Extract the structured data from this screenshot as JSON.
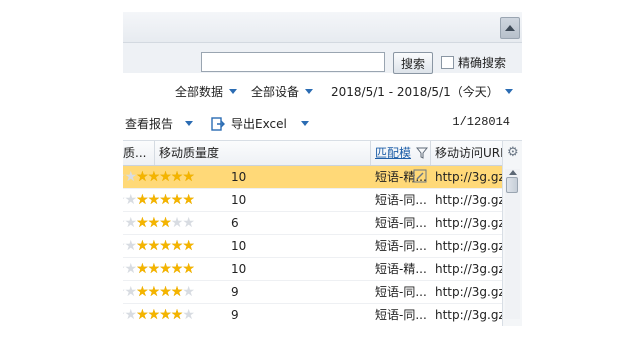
{
  "search": {
    "value": "",
    "button_label": "搜索",
    "exact_label": "精确搜索"
  },
  "filters": {
    "data_scope": "全部数据",
    "device": "全部设备",
    "date_range": "2018/5/1 - 2018/5/1（今天）"
  },
  "toolbar": {
    "report_label": "查看报告",
    "export_label": "导出Excel",
    "page_count": "1/128014"
  },
  "columns": {
    "quality_prev": "质...",
    "mobile_quality": "移动质量度",
    "match_mode": "匹配模",
    "mobile_url": "移动访问URL"
  },
  "rows": [
    {
      "score": "10",
      "stars": 10,
      "match": "短语-精...",
      "url": "http://3g.gz",
      "selected": true
    },
    {
      "score": "10",
      "stars": 10,
      "match": "短语-同...",
      "url": "http://3g.gz",
      "selected": false
    },
    {
      "score": "6",
      "stars": 6,
      "match": "短语-同...",
      "url": "http://3g.gz",
      "selected": false
    },
    {
      "score": "10",
      "stars": 10,
      "match": "短语-同...",
      "url": "http://3g.gz",
      "selected": false
    },
    {
      "score": "10",
      "stars": 10,
      "match": "短语-精...",
      "url": "http://3g.gz",
      "selected": false
    },
    {
      "score": "9",
      "stars": 9,
      "match": "短语-同...",
      "url": "http://3g.gz",
      "selected": false
    },
    {
      "score": "9",
      "stars": 9,
      "match": "短语-同...",
      "url": "http://3g.gz",
      "selected": false
    }
  ],
  "colors": {
    "selected_row": "#ffd978",
    "star_on": "#f4b400",
    "accent": "#2b6cb3"
  },
  "icons": {
    "scroll_up": "triangle-up-icon",
    "export": "export-icon",
    "filter": "funnel-icon",
    "settings": "gear-icon",
    "edit": "edit-icon"
  }
}
